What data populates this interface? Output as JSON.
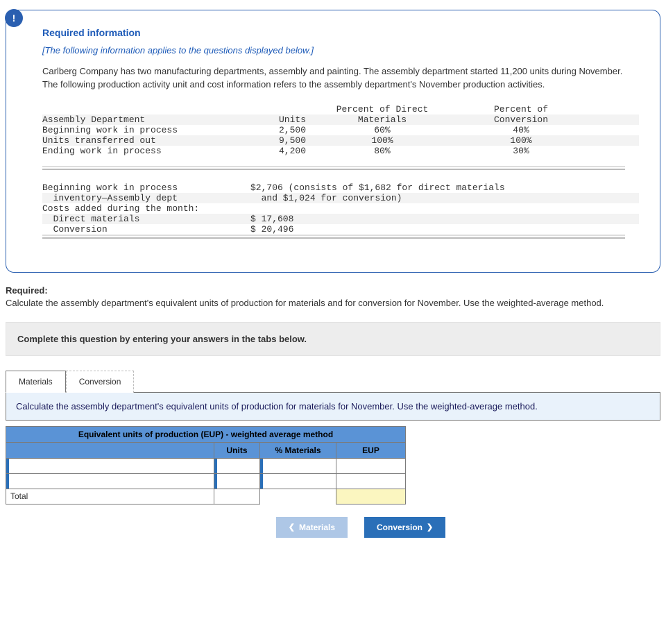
{
  "info": {
    "title": "Required information",
    "subtitle": "[The following information applies to the questions displayed below.]",
    "body": "Carlberg Company has two manufacturing departments, assembly and painting. The assembly department started 11,200 units during November. The following production activity unit and cost information refers to the assembly department's November production activities."
  },
  "table1": {
    "headers": {
      "c1": "Assembly Department",
      "c2": "Units",
      "c3": "Percent of Direct Materials",
      "c4": "Percent of Conversion"
    },
    "rows": [
      {
        "c1": "Beginning work in process",
        "c2": "2,500",
        "c3": "60%",
        "c4": "40%"
      },
      {
        "c1": "Units transferred out",
        "c2": "9,500",
        "c3": "100%",
        "c4": "100%"
      },
      {
        "c1": "Ending work in process",
        "c2": "4,200",
        "c3": "80%",
        "c4": "30%"
      }
    ]
  },
  "table2": {
    "rows": [
      {
        "c1": "Beginning work in process",
        "c2": "$2,706 (consists of $1,682 for direct materials"
      },
      {
        "c1": "  inventory—Assembly dept",
        "c2": "  and $1,024 for conversion)"
      },
      {
        "c1": "Costs added during the month:",
        "c2": ""
      },
      {
        "c1": "  Direct materials",
        "c2": "$ 17,608"
      },
      {
        "c1": "  Conversion",
        "c2": "$ 20,496"
      }
    ]
  },
  "required": {
    "label": "Required:",
    "desc": "Calculate the assembly department's equivalent units of production for materials and for conversion for November. Use the weighted-average method."
  },
  "instruction": "Complete this question by entering your answers in the tabs below.",
  "tabs": {
    "materials": "Materials",
    "conversion": "Conversion"
  },
  "panel": {
    "prompt": "Calculate the assembly department's equivalent units of production for materials for November. Use the weighted-average method.",
    "table_title": "Equivalent units of production (EUP) - weighted average method",
    "col_units": "Units",
    "col_pct": "% Materials",
    "col_eup": "EUP",
    "total_label": "Total"
  },
  "nav": {
    "prev": "Materials",
    "next": "Conversion"
  }
}
